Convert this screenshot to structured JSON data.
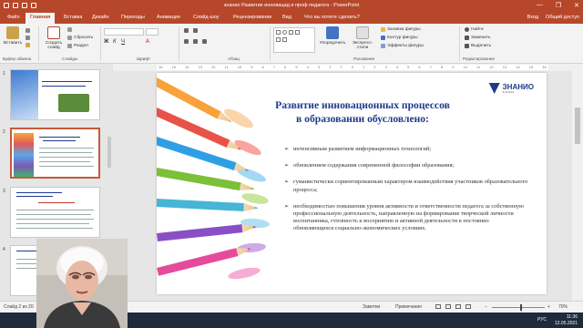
{
  "window": {
    "title": "знанио Развитие инновацид и проф педагога - PowerPoint",
    "controls": [
      "—",
      "❐",
      "✕"
    ]
  },
  "tabs": [
    {
      "label": "Файл"
    },
    {
      "label": "Главная",
      "active": true
    },
    {
      "label": "Вставка"
    },
    {
      "label": "Дизайн"
    },
    {
      "label": "Переходы"
    },
    {
      "label": "Анимация"
    },
    {
      "label": "Слайд-шоу"
    },
    {
      "label": "Рецензирование"
    },
    {
      "label": "Вид"
    },
    {
      "label": "Что вы хотите сделать?"
    }
  ],
  "tabs_right": {
    "signin": "Вход",
    "share": "Общий доступ"
  },
  "ribbon": {
    "paste": "Вставить",
    "create_slide": "Создать слайд",
    "cut": "Вырезать",
    "reset": "Сбросить",
    "section": "Раздел",
    "arrange": "Упорядочить",
    "quick_styles": "Экспресс-стили",
    "fill": "Заливка фигуры",
    "outline": "Контур фигуры",
    "effects": "Эффекты фигуры",
    "find": "Найти",
    "replace": "Заменить",
    "select": "Выделить",
    "groups": {
      "clipboard": "Буфер обмена",
      "slides": "Слайды",
      "font": "Шрифт",
      "paragraph": "Абзац",
      "drawing": "Рисование",
      "editing": "Редактирование"
    }
  },
  "ruler_ticks": [
    "16",
    "15",
    "14",
    "13",
    "12",
    "11",
    "10",
    "9",
    "8",
    "7",
    "6",
    "5",
    "4",
    "3",
    "2",
    "1",
    "0",
    "1",
    "2",
    "3",
    "4",
    "5",
    "6",
    "7",
    "8",
    "9",
    "10",
    "11",
    "12",
    "13",
    "14",
    "15",
    "16"
  ],
  "thumbnails": [
    {
      "num": "1"
    },
    {
      "num": "2",
      "selected": true
    },
    {
      "num": "3"
    },
    {
      "num": "4"
    }
  ],
  "slide": {
    "title_line1": "Развитие инновационных процессов",
    "title_line2": "в образовании обусловлено:",
    "logo_text": "ЗНАНИО",
    "logo_sub": "ЗНАНИЕ",
    "bullets": [
      "интенсивным развитием информационных технологий;",
      "обновлением содержания современной философии образования;",
      "гуманистически сориентированным характером взаимодействия участников образовательного процесса;",
      "необходимостью повышения уровня активности и ответственности педагога за собственную профессиональную деятельность, направленную на формирование творческой личности воспитанника, готовность к восприятию и активной деятельности в постоянно обновляющихся социально-экономических условиях."
    ],
    "bullet_mark": "➢"
  },
  "status": {
    "slide_info": "Слайд 2 из 20",
    "notes": "Заметки",
    "comments": "Примечания",
    "zoom": "70%"
  },
  "taskbar": {
    "lang": "РУС",
    "time": "11:36",
    "date": "12.05.2021"
  }
}
